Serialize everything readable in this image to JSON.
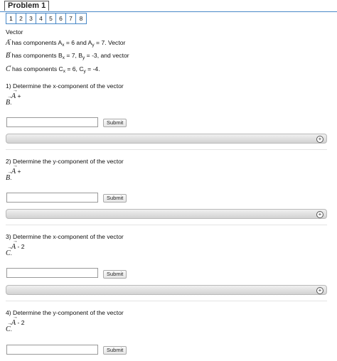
{
  "header": {
    "problem_title": "Problem 1"
  },
  "tabs": [
    "1",
    "2",
    "3",
    "4",
    "5",
    "6",
    "7",
    "8"
  ],
  "intro": {
    "line0": "Vector",
    "vecA": "A",
    "line1_text": " has components A",
    "line1_sub1": "x",
    "line1_mid": " = 6 and A",
    "line1_sub2": "y",
    "line1_end": " = 7. Vector",
    "vecB": "B",
    "line2_text": " has components B",
    "line2_sub1": "x",
    "line2_mid": " = 7, B",
    "line2_sub2": "y",
    "line2_end": " = -3, and vector",
    "vecC": "C",
    "line3_text": " has components C",
    "line3_sub1": "x",
    "line3_mid": " = 6, C",
    "line3_sub2": "y",
    "line3_end": " = -4."
  },
  "questions": [
    {
      "title": "1) Determine the x-component of the vector",
      "vec1": "A",
      "op": " +",
      "vec2": "B",
      "tail": "."
    },
    {
      "title": "2) Determine the y-component of the vector",
      "vec1": "A",
      "op": " +",
      "vec2": "B",
      "tail": "."
    },
    {
      "title": "3) Determine the x-component of the vector",
      "vec1": "A",
      "op": " - 2",
      "vec2": "C",
      "tail": "."
    },
    {
      "title": "4) Determine the y-component of the vector",
      "vec1": "A",
      "op": " - 2",
      "vec2": "C",
      "tail": "."
    }
  ],
  "submit_label": "Submit",
  "hint_icon": "plus-circle-icon",
  "colors": {
    "accent": "#4a89c8",
    "hint_bar": "#d8d8d8"
  }
}
